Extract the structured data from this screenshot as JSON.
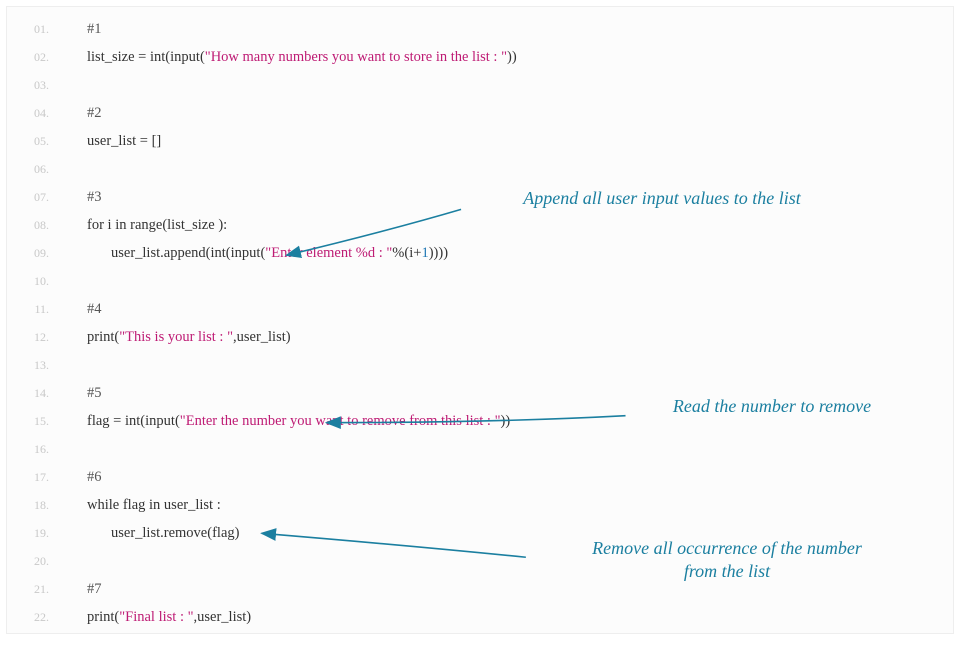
{
  "annotations": {
    "a1": "Append all user input values to the list",
    "a2": "Read the number to remove",
    "a3_l1": "Remove all occurrence of the number",
    "a3_l2": "from the list"
  },
  "code": {
    "lines": [
      {
        "n": "01.",
        "indent": 0,
        "tokens": [
          {
            "t": "#1",
            "c": "comment"
          }
        ]
      },
      {
        "n": "02.",
        "indent": 0,
        "tokens": [
          {
            "t": "list_size ",
            "c": "ident"
          },
          {
            "t": "= ",
            "c": "op"
          },
          {
            "t": "int",
            "c": "builtin"
          },
          {
            "t": "(",
            "c": "op"
          },
          {
            "t": "input",
            "c": "builtin"
          },
          {
            "t": "(",
            "c": "op"
          },
          {
            "t": "\"How many numbers you want to store in the list : \"",
            "c": "str"
          },
          {
            "t": "))",
            "c": "op"
          }
        ]
      },
      {
        "n": "03.",
        "indent": 0,
        "tokens": []
      },
      {
        "n": "04.",
        "indent": 0,
        "tokens": [
          {
            "t": "#2",
            "c": "comment"
          }
        ]
      },
      {
        "n": "05.",
        "indent": 0,
        "tokens": [
          {
            "t": "user_list ",
            "c": "ident"
          },
          {
            "t": "= ",
            "c": "op"
          },
          {
            "t": "[]",
            "c": "op"
          }
        ]
      },
      {
        "n": "06.",
        "indent": 0,
        "tokens": []
      },
      {
        "n": "07.",
        "indent": 0,
        "tokens": [
          {
            "t": "#3",
            "c": "comment"
          }
        ]
      },
      {
        "n": "08.",
        "indent": 0,
        "tokens": [
          {
            "t": "for ",
            "c": "kw"
          },
          {
            "t": "i ",
            "c": "ident"
          },
          {
            "t": "in ",
            "c": "kw"
          },
          {
            "t": "range",
            "c": "builtin"
          },
          {
            "t": "(",
            "c": "op"
          },
          {
            "t": "list_size ",
            "c": "ident"
          },
          {
            "t": "):",
            "c": "op"
          }
        ]
      },
      {
        "n": "09.",
        "indent": 1,
        "tokens": [
          {
            "t": "user_list",
            "c": "ident"
          },
          {
            "t": ".",
            "c": "op"
          },
          {
            "t": "append",
            "c": "builtin"
          },
          {
            "t": "(",
            "c": "op"
          },
          {
            "t": "int",
            "c": "builtin"
          },
          {
            "t": "(",
            "c": "op"
          },
          {
            "t": "input",
            "c": "builtin"
          },
          {
            "t": "(",
            "c": "op"
          },
          {
            "t": "\"Enter element %d : \"",
            "c": "str"
          },
          {
            "t": "%",
            "c": "op"
          },
          {
            "t": "(",
            "c": "op"
          },
          {
            "t": "i",
            "c": "ident"
          },
          {
            "t": "+",
            "c": "op"
          },
          {
            "t": "1",
            "c": "num"
          },
          {
            "t": "))))",
            "c": "op"
          }
        ]
      },
      {
        "n": "10.",
        "indent": 0,
        "tokens": []
      },
      {
        "n": "11.",
        "indent": 0,
        "tokens": [
          {
            "t": "#4",
            "c": "comment"
          }
        ]
      },
      {
        "n": "12.",
        "indent": 0,
        "tokens": [
          {
            "t": "print",
            "c": "builtin"
          },
          {
            "t": "(",
            "c": "op"
          },
          {
            "t": "\"This is your list : \"",
            "c": "str"
          },
          {
            "t": ",",
            "c": "op"
          },
          {
            "t": "user_list",
            "c": "ident"
          },
          {
            "t": ")",
            "c": "op"
          }
        ]
      },
      {
        "n": "13.",
        "indent": 0,
        "tokens": []
      },
      {
        "n": "14.",
        "indent": 0,
        "tokens": [
          {
            "t": "#5",
            "c": "comment"
          }
        ]
      },
      {
        "n": "15.",
        "indent": 0,
        "tokens": [
          {
            "t": "flag ",
            "c": "ident"
          },
          {
            "t": "= ",
            "c": "op"
          },
          {
            "t": "int",
            "c": "builtin"
          },
          {
            "t": "(",
            "c": "op"
          },
          {
            "t": "input",
            "c": "builtin"
          },
          {
            "t": "(",
            "c": "op"
          },
          {
            "t": "\"Enter the number you want to remove from this list : \"",
            "c": "str"
          },
          {
            "t": "))",
            "c": "op"
          }
        ]
      },
      {
        "n": "16.",
        "indent": 0,
        "tokens": []
      },
      {
        "n": "17.",
        "indent": 0,
        "tokens": [
          {
            "t": "#6",
            "c": "comment"
          }
        ]
      },
      {
        "n": "18.",
        "indent": 0,
        "tokens": [
          {
            "t": "while ",
            "c": "kw"
          },
          {
            "t": "flag ",
            "c": "ident"
          },
          {
            "t": "in ",
            "c": "kw"
          },
          {
            "t": "user_list ",
            "c": "ident"
          },
          {
            "t": ":",
            "c": "op"
          }
        ]
      },
      {
        "n": "19.",
        "indent": 1,
        "tokens": [
          {
            "t": "user_list",
            "c": "ident"
          },
          {
            "t": ".",
            "c": "op"
          },
          {
            "t": "remove",
            "c": "builtin"
          },
          {
            "t": "(",
            "c": "op"
          },
          {
            "t": "flag",
            "c": "ident"
          },
          {
            "t": ")",
            "c": "op"
          }
        ]
      },
      {
        "n": "20.",
        "indent": 0,
        "tokens": []
      },
      {
        "n": "21.",
        "indent": 0,
        "tokens": [
          {
            "t": "#7",
            "c": "comment"
          }
        ]
      },
      {
        "n": "22.",
        "indent": 0,
        "tokens": [
          {
            "t": "print",
            "c": "builtin"
          },
          {
            "t": "(",
            "c": "op"
          },
          {
            "t": "\"Final list : \"",
            "c": "str"
          },
          {
            "t": ",",
            "c": "op"
          },
          {
            "t": "user_list",
            "c": "ident"
          },
          {
            "t": ")",
            "c": "op"
          }
        ]
      }
    ]
  }
}
